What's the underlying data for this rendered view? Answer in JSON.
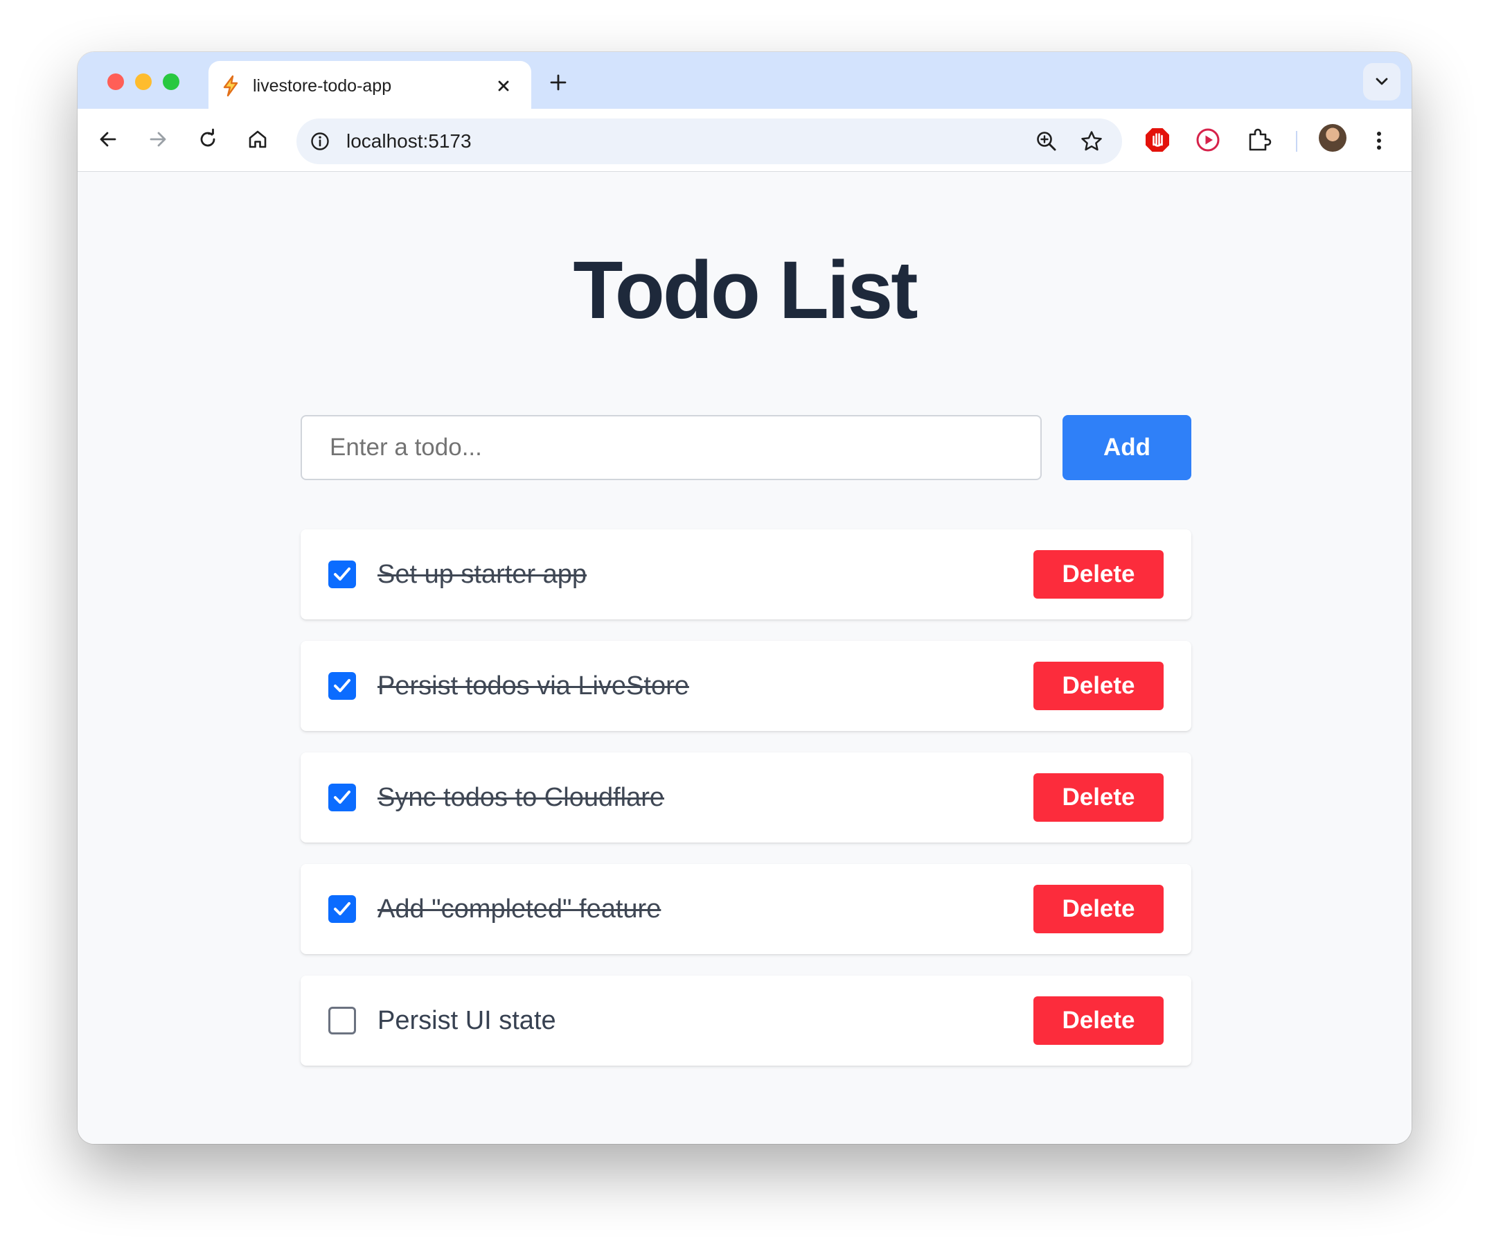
{
  "browser": {
    "tab": {
      "title": "livestore-todo-app",
      "favicon": "lightning-icon"
    },
    "address_bar": {
      "url": "localhost:5173"
    }
  },
  "app": {
    "title": "Todo List",
    "input": {
      "placeholder": "Enter a todo...",
      "value": ""
    },
    "add_label": "Add",
    "todos": [
      {
        "text": "Set up starter app",
        "completed": true,
        "delete_label": "Delete"
      },
      {
        "text": "Persist todos via LiveStore",
        "completed": true,
        "delete_label": "Delete"
      },
      {
        "text": "Sync todos to Cloudflare",
        "completed": true,
        "delete_label": "Delete"
      },
      {
        "text": "Add \"completed\" feature",
        "completed": true,
        "delete_label": "Delete"
      },
      {
        "text": "Persist UI state",
        "completed": false,
        "delete_label": "Delete"
      }
    ]
  },
  "colors": {
    "tab_strip": "#d3e3fd",
    "page_background": "#f8f9fb",
    "title": "#1e293b",
    "add_button": "#2f80f8",
    "delete_button": "#fc2c3c",
    "checkbox_checked": "#0b6cff"
  }
}
